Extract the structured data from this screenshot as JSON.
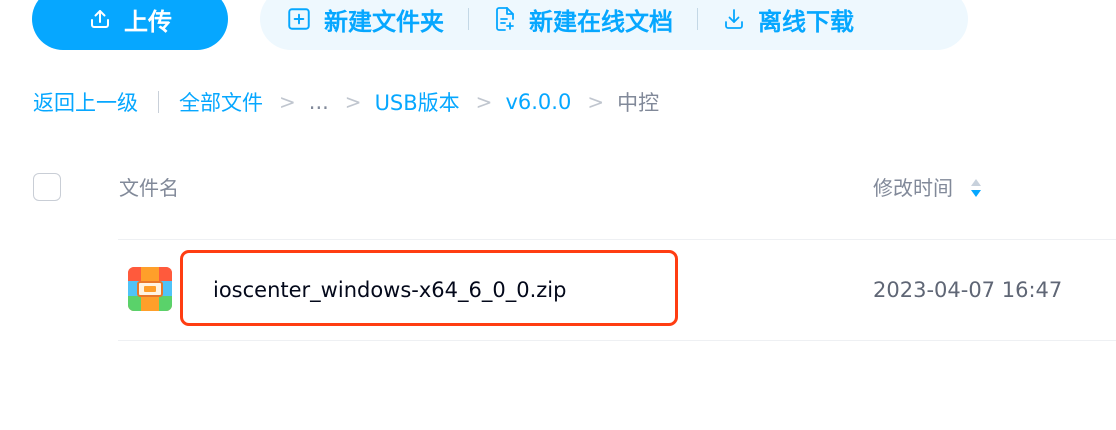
{
  "toolbar": {
    "upload_label": "上传",
    "actions": [
      {
        "label": "新建文件夹",
        "icon": "folder-plus-icon"
      },
      {
        "label": "新建在线文档",
        "icon": "document-edit-icon"
      },
      {
        "label": "离线下载",
        "icon": "download-icon"
      }
    ],
    "accent_color": "#06a7ff"
  },
  "breadcrumb": {
    "back_label": "返回上一级",
    "items": [
      "全部文件",
      "...",
      "USB版本",
      "v6.0.0"
    ],
    "current": "中控"
  },
  "table": {
    "columns": {
      "name": "文件名",
      "modified": "修改时间"
    },
    "rows": [
      {
        "name": "ioscenter_windows-x64_6_0_0.zip",
        "modified": "2023-04-07 16:47",
        "icon": "zip-archive-icon"
      }
    ]
  },
  "annotation": {
    "highlight_color": "#ff3d12"
  }
}
